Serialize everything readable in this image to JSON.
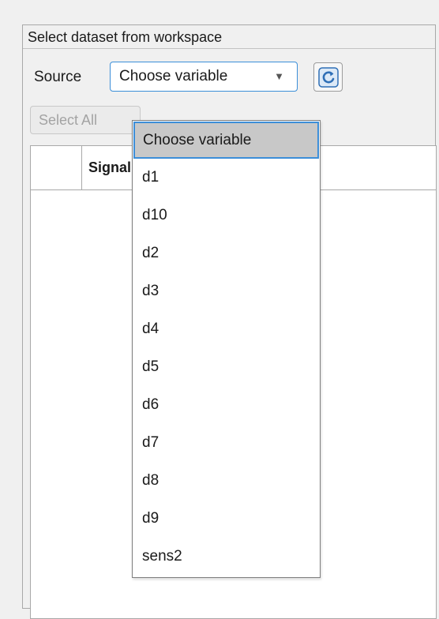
{
  "panel": {
    "title": "Select dataset from workspace"
  },
  "source": {
    "label": "Source",
    "selected": "Choose variable",
    "arrow": "▼"
  },
  "refresh": {
    "icon": "refresh-icon"
  },
  "select_all": {
    "label": "Select All"
  },
  "table": {
    "signal_header": "Signal"
  },
  "dropdown_menu": {
    "items": [
      "Choose variable",
      "d1",
      "d10",
      "d2",
      "d3",
      "d4",
      "d5",
      "d6",
      "d7",
      "d8",
      "d9",
      "sens2"
    ],
    "selected_index": 0
  },
  "colors": {
    "accent": "#3c8ed8",
    "selected_bg": "#c8c8c8",
    "refresh_blue": "#2f6fb6"
  }
}
